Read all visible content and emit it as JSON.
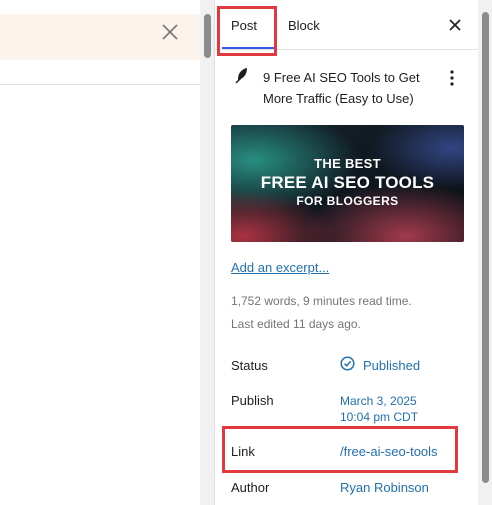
{
  "tabs": [
    {
      "label": "Post",
      "active": true
    },
    {
      "label": "Block",
      "active": false
    }
  ],
  "post": {
    "title": "9 Free AI SEO Tools to Get More Traffic (Easy to Use)",
    "featured_image": {
      "line1": "THE BEST",
      "line2": "FREE AI SEO TOOLS",
      "line3": "FOR BLOGGERS"
    },
    "excerpt_link": "Add an excerpt...",
    "stats": "1,752 words, 9 minutes read time.",
    "last_edited": "Last edited 11 days ago."
  },
  "details": {
    "status_label": "Status",
    "status_value": "Published",
    "publish_label": "Publish",
    "publish_date": "March 3, 2025",
    "publish_time": "10:04 pm CDT",
    "link_label": "Link",
    "link_value": "/free-ai-seo-tools",
    "author_label": "Author",
    "author_value": "Ryan Robinson"
  },
  "colors": {
    "accent": "#3858e9",
    "link": "#2271b1",
    "highlight": "#e2393f",
    "notice_bg": "#fcf4ec"
  },
  "icons": {
    "notice_close": "close-icon",
    "sidebar_close": "close-icon",
    "post_type": "feather-icon",
    "more": "more-vertical-icon",
    "status": "check-circle-icon"
  }
}
